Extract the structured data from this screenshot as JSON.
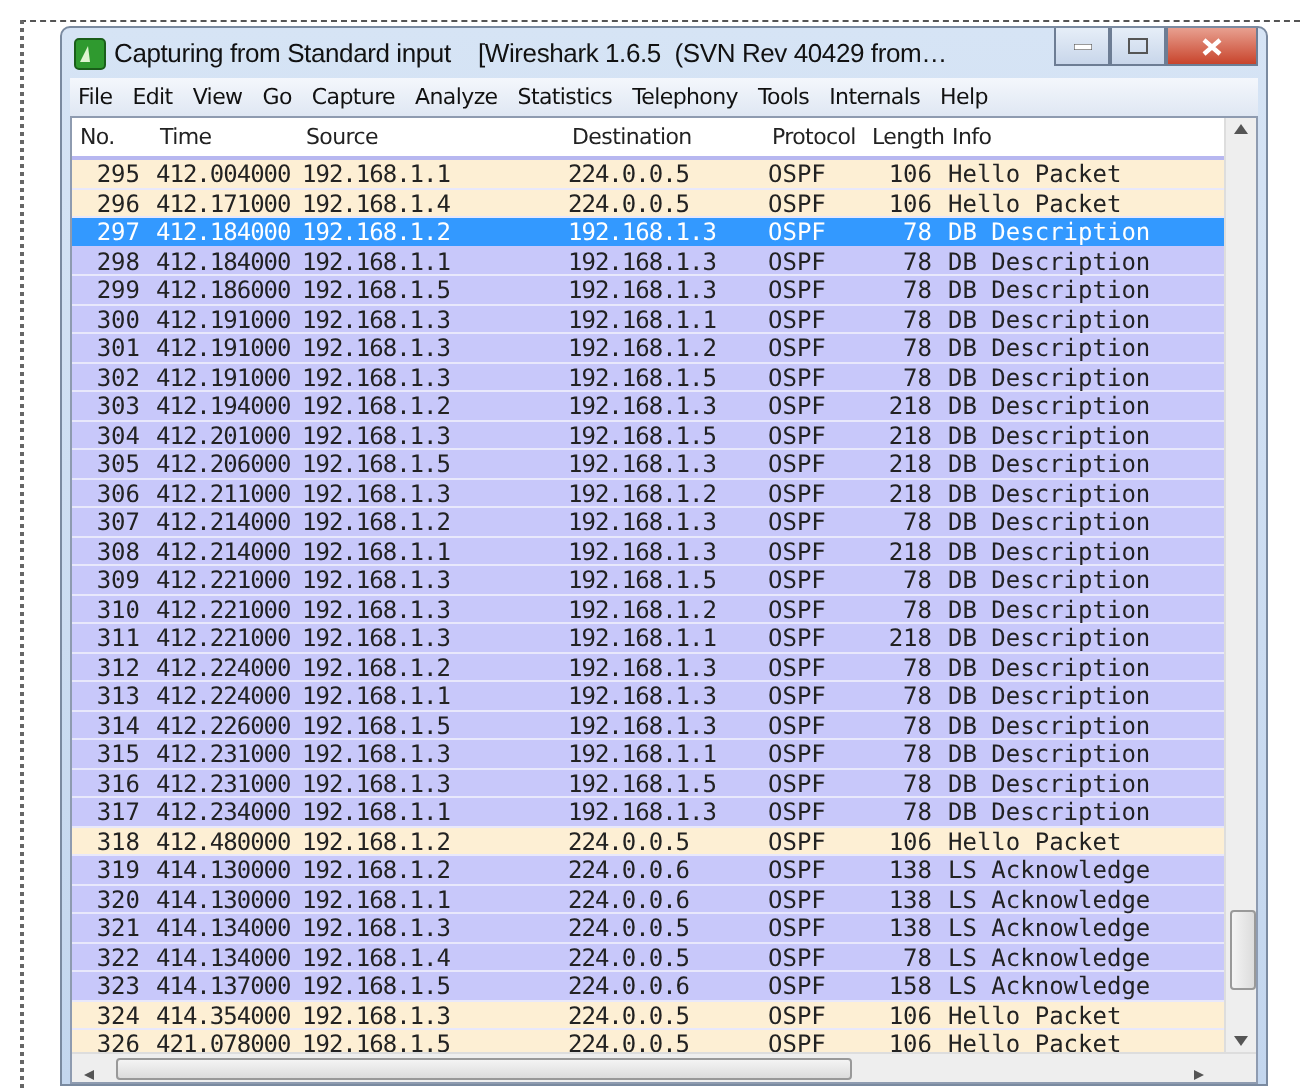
{
  "window": {
    "title": "Capturing from Standard input    [Wireshark 1.6.5  (SVN Rev 40429 from…"
  },
  "menu": [
    "File",
    "Edit",
    "View",
    "Go",
    "Capture",
    "Analyze",
    "Statistics",
    "Telephony",
    "Tools",
    "Internals",
    "Help"
  ],
  "table": {
    "columns": [
      "No.",
      "Time",
      "Source",
      "Destination",
      "Protocol",
      "Length",
      "Info"
    ],
    "rows": [
      {
        "no": "295",
        "time": "412.004000",
        "source": "192.168.1.1",
        "destination": "224.0.0.5",
        "protocol": "OSPF",
        "length": "106",
        "info": "Hello Packet",
        "color": "#fdefd4",
        "selected": false
      },
      {
        "no": "296",
        "time": "412.171000",
        "source": "192.168.1.4",
        "destination": "224.0.0.5",
        "protocol": "OSPF",
        "length": "106",
        "info": "Hello Packet",
        "color": "#fdefd4",
        "selected": false
      },
      {
        "no": "297",
        "time": "412.184000",
        "source": "192.168.1.2",
        "destination": "192.168.1.3",
        "protocol": "OSPF",
        "length": "78",
        "info": "DB Description",
        "color": "#c8c8fa",
        "selected": true
      },
      {
        "no": "298",
        "time": "412.184000",
        "source": "192.168.1.1",
        "destination": "192.168.1.3",
        "protocol": "OSPF",
        "length": "78",
        "info": "DB Description",
        "color": "#c8c8fa",
        "selected": false
      },
      {
        "no": "299",
        "time": "412.186000",
        "source": "192.168.1.5",
        "destination": "192.168.1.3",
        "protocol": "OSPF",
        "length": "78",
        "info": "DB Description",
        "color": "#c8c8fa",
        "selected": false
      },
      {
        "no": "300",
        "time": "412.191000",
        "source": "192.168.1.3",
        "destination": "192.168.1.1",
        "protocol": "OSPF",
        "length": "78",
        "info": "DB Description",
        "color": "#c8c8fa",
        "selected": false
      },
      {
        "no": "301",
        "time": "412.191000",
        "source": "192.168.1.3",
        "destination": "192.168.1.2",
        "protocol": "OSPF",
        "length": "78",
        "info": "DB Description",
        "color": "#c8c8fa",
        "selected": false
      },
      {
        "no": "302",
        "time": "412.191000",
        "source": "192.168.1.3",
        "destination": "192.168.1.5",
        "protocol": "OSPF",
        "length": "78",
        "info": "DB Description",
        "color": "#c8c8fa",
        "selected": false
      },
      {
        "no": "303",
        "time": "412.194000",
        "source": "192.168.1.2",
        "destination": "192.168.1.3",
        "protocol": "OSPF",
        "length": "218",
        "info": "DB Description",
        "color": "#c8c8fa",
        "selected": false
      },
      {
        "no": "304",
        "time": "412.201000",
        "source": "192.168.1.3",
        "destination": "192.168.1.5",
        "protocol": "OSPF",
        "length": "218",
        "info": "DB Description",
        "color": "#c8c8fa",
        "selected": false
      },
      {
        "no": "305",
        "time": "412.206000",
        "source": "192.168.1.5",
        "destination": "192.168.1.3",
        "protocol": "OSPF",
        "length": "218",
        "info": "DB Description",
        "color": "#c8c8fa",
        "selected": false
      },
      {
        "no": "306",
        "time": "412.211000",
        "source": "192.168.1.3",
        "destination": "192.168.1.2",
        "protocol": "OSPF",
        "length": "218",
        "info": "DB Description",
        "color": "#c8c8fa",
        "selected": false
      },
      {
        "no": "307",
        "time": "412.214000",
        "source": "192.168.1.2",
        "destination": "192.168.1.3",
        "protocol": "OSPF",
        "length": "78",
        "info": "DB Description",
        "color": "#c8c8fa",
        "selected": false
      },
      {
        "no": "308",
        "time": "412.214000",
        "source": "192.168.1.1",
        "destination": "192.168.1.3",
        "protocol": "OSPF",
        "length": "218",
        "info": "DB Description",
        "color": "#c8c8fa",
        "selected": false
      },
      {
        "no": "309",
        "time": "412.221000",
        "source": "192.168.1.3",
        "destination": "192.168.1.5",
        "protocol": "OSPF",
        "length": "78",
        "info": "DB Description",
        "color": "#c8c8fa",
        "selected": false
      },
      {
        "no": "310",
        "time": "412.221000",
        "source": "192.168.1.3",
        "destination": "192.168.1.2",
        "protocol": "OSPF",
        "length": "78",
        "info": "DB Description",
        "color": "#c8c8fa",
        "selected": false
      },
      {
        "no": "311",
        "time": "412.221000",
        "source": "192.168.1.3",
        "destination": "192.168.1.1",
        "protocol": "OSPF",
        "length": "218",
        "info": "DB Description",
        "color": "#c8c8fa",
        "selected": false
      },
      {
        "no": "312",
        "time": "412.224000",
        "source": "192.168.1.2",
        "destination": "192.168.1.3",
        "protocol": "OSPF",
        "length": "78",
        "info": "DB Description",
        "color": "#c8c8fa",
        "selected": false
      },
      {
        "no": "313",
        "time": "412.224000",
        "source": "192.168.1.1",
        "destination": "192.168.1.3",
        "protocol": "OSPF",
        "length": "78",
        "info": "DB Description",
        "color": "#c8c8fa",
        "selected": false
      },
      {
        "no": "314",
        "time": "412.226000",
        "source": "192.168.1.5",
        "destination": "192.168.1.3",
        "protocol": "OSPF",
        "length": "78",
        "info": "DB Description",
        "color": "#c8c8fa",
        "selected": false
      },
      {
        "no": "315",
        "time": "412.231000",
        "source": "192.168.1.3",
        "destination": "192.168.1.1",
        "protocol": "OSPF",
        "length": "78",
        "info": "DB Description",
        "color": "#c8c8fa",
        "selected": false
      },
      {
        "no": "316",
        "time": "412.231000",
        "source": "192.168.1.3",
        "destination": "192.168.1.5",
        "protocol": "OSPF",
        "length": "78",
        "info": "DB Description",
        "color": "#c8c8fa",
        "selected": false
      },
      {
        "no": "317",
        "time": "412.234000",
        "source": "192.168.1.1",
        "destination": "192.168.1.3",
        "protocol": "OSPF",
        "length": "78",
        "info": "DB Description",
        "color": "#c8c8fa",
        "selected": false
      },
      {
        "no": "318",
        "time": "412.480000",
        "source": "192.168.1.2",
        "destination": "224.0.0.5",
        "protocol": "OSPF",
        "length": "106",
        "info": "Hello Packet",
        "color": "#fdefd4",
        "selected": false
      },
      {
        "no": "319",
        "time": "414.130000",
        "source": "192.168.1.2",
        "destination": "224.0.0.6",
        "protocol": "OSPF",
        "length": "138",
        "info": "LS Acknowledge",
        "color": "#c8c8fa",
        "selected": false
      },
      {
        "no": "320",
        "time": "414.130000",
        "source": "192.168.1.1",
        "destination": "224.0.0.6",
        "protocol": "OSPF",
        "length": "138",
        "info": "LS Acknowledge",
        "color": "#c8c8fa",
        "selected": false
      },
      {
        "no": "321",
        "time": "414.134000",
        "source": "192.168.1.3",
        "destination": "224.0.0.5",
        "protocol": "OSPF",
        "length": "138",
        "info": "LS Acknowledge",
        "color": "#c8c8fa",
        "selected": false
      },
      {
        "no": "322",
        "time": "414.134000",
        "source": "192.168.1.4",
        "destination": "224.0.0.5",
        "protocol": "OSPF",
        "length": "78",
        "info": "LS Acknowledge",
        "color": "#c8c8fa",
        "selected": false
      },
      {
        "no": "323",
        "time": "414.137000",
        "source": "192.168.1.5",
        "destination": "224.0.0.6",
        "protocol": "OSPF",
        "length": "158",
        "info": "LS Acknowledge",
        "color": "#c8c8fa",
        "selected": false
      },
      {
        "no": "324",
        "time": "414.354000",
        "source": "192.168.1.3",
        "destination": "224.0.0.5",
        "protocol": "OSPF",
        "length": "106",
        "info": "Hello Packet",
        "color": "#fdefd4",
        "selected": false
      },
      {
        "no": "326",
        "time": "421.078000",
        "source": "192.168.1.5",
        "destination": "224.0.0.5",
        "protocol": "OSPF",
        "length": "106",
        "info": "Hello Packet",
        "color": "#fdefd4",
        "selected": false
      }
    ]
  }
}
